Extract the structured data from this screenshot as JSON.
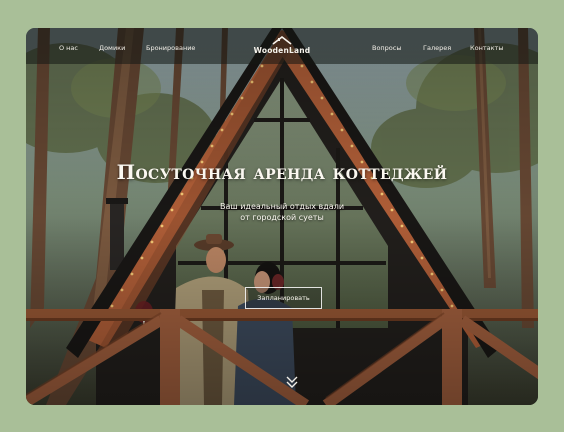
{
  "nav": {
    "left_links": [
      "О нас",
      "Домики",
      "Бронирование"
    ],
    "right_links": [
      "Вопросы",
      "Галерея",
      "Контакты"
    ],
    "logo_text": "WoodenLand"
  },
  "hero": {
    "title": "Посуточная аренда коттеджей",
    "subtitle_line1": "Ваш идеальный отдых вдали",
    "subtitle_line2": "от городской суеты",
    "cta_label": "Запланировать"
  },
  "icons": {
    "logo": "house-roof-icon",
    "scroll": "double-chevron-down-icon"
  },
  "colors": {
    "page_background": "#a9bf98",
    "accent_wood": "#b7623a",
    "text_light": "#fbf8f1",
    "cabin_dark": "#23201d"
  }
}
